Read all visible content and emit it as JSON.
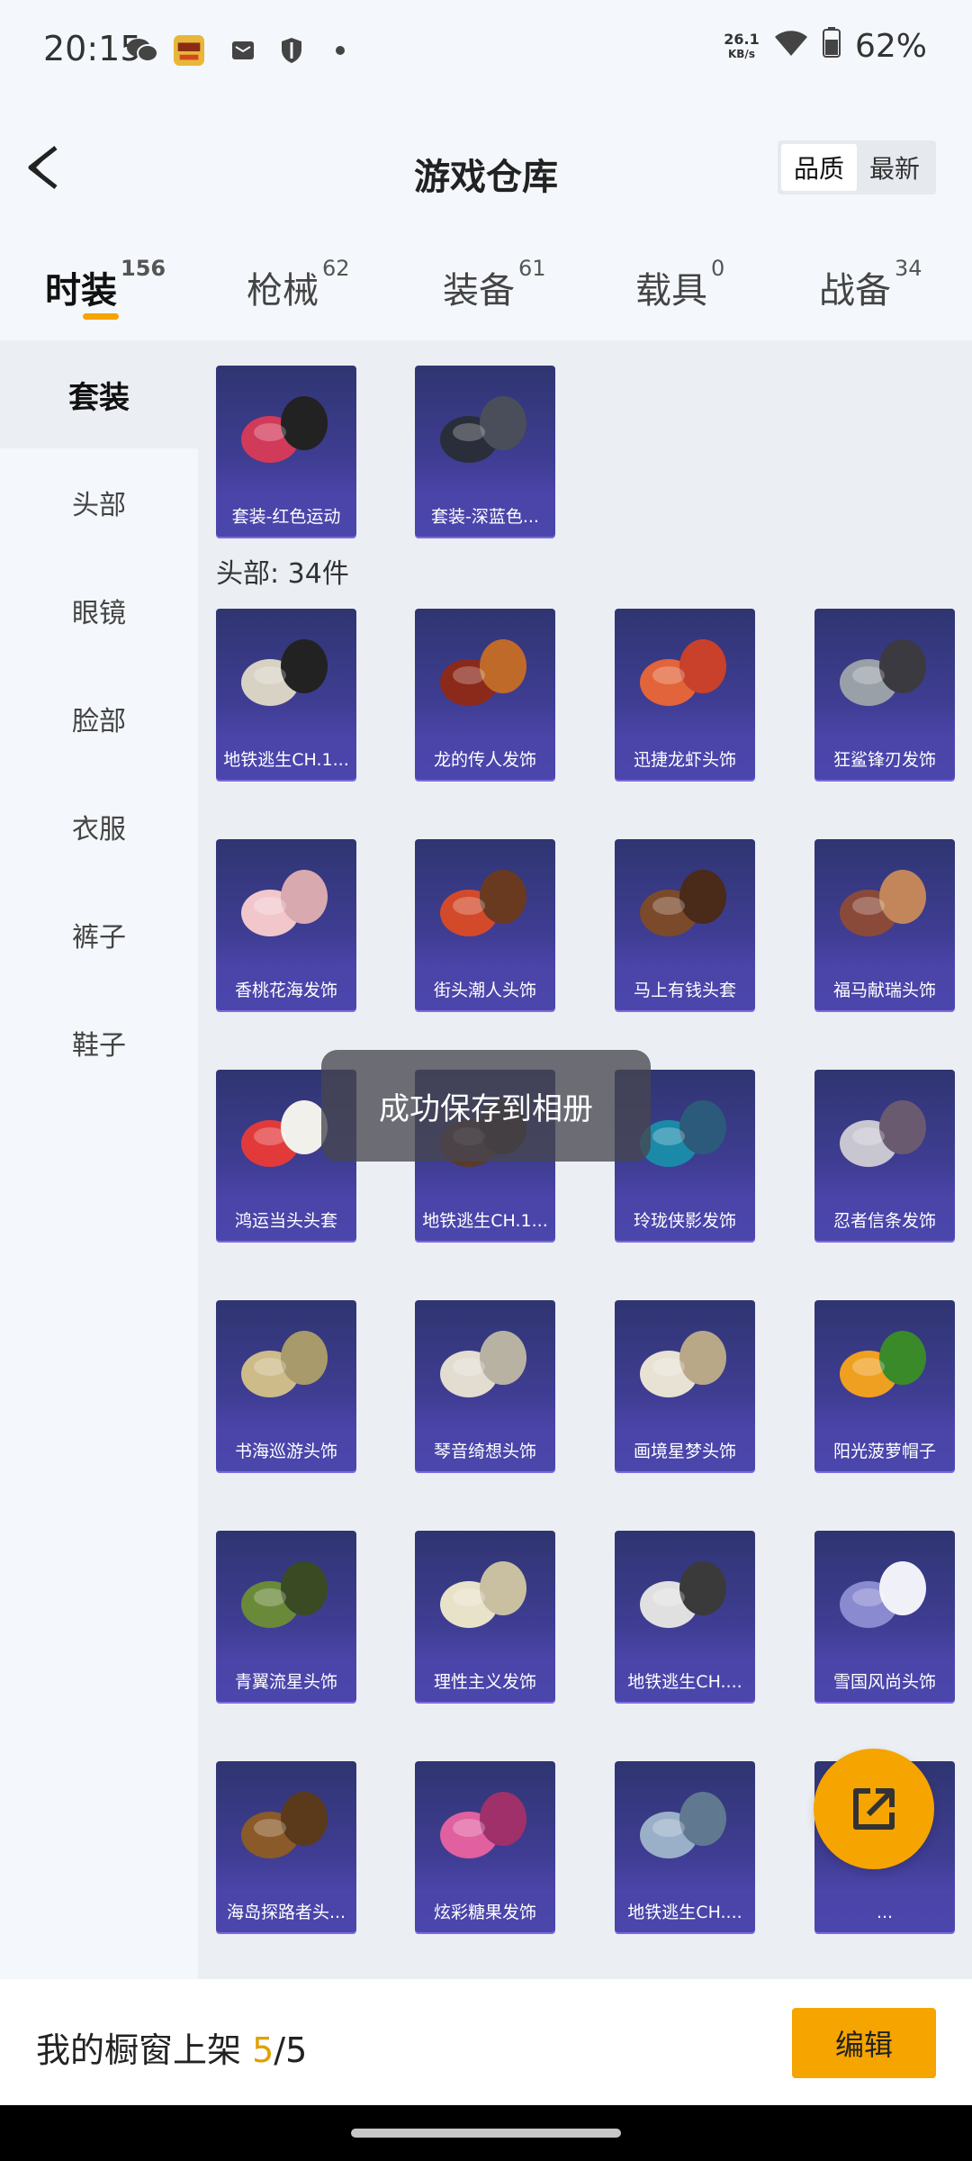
{
  "status_bar": {
    "time": "20:15",
    "speed_top": "26.1",
    "speed_unit": "KB/s",
    "battery": "62%",
    "icons": [
      "wechat-icon",
      "app-icon",
      "mail-icon",
      "shield-icon",
      "dot-icon",
      "wifi-icon",
      "battery-icon"
    ]
  },
  "header": {
    "title": "游戏仓库",
    "sort_options": [
      "品质",
      "最新"
    ],
    "active_sort": "品质"
  },
  "tabs": [
    {
      "label": "时装",
      "count": "156",
      "active": true
    },
    {
      "label": "枪械",
      "count": "62",
      "active": false
    },
    {
      "label": "装备",
      "count": "61",
      "active": false
    },
    {
      "label": "载具",
      "count": "0",
      "active": false
    },
    {
      "label": "战备",
      "count": "34",
      "active": false
    }
  ],
  "sidebar": {
    "items": [
      "套装",
      "头部",
      "眼镜",
      "脸部",
      "衣服",
      "裤子",
      "鞋子"
    ],
    "active": "套装"
  },
  "suits": {
    "items": [
      "套装-红色运动",
      "套装-深蓝色..."
    ]
  },
  "head_section": {
    "title": "头部: 34件",
    "items": [
      "地铁逃生CH.1...",
      "龙的传人发饰",
      "迅捷龙虾头饰",
      "狂鲨锋刃发饰",
      "香桃花海发饰",
      "街头潮人头饰",
      "马上有钱头套",
      "福马献瑞头饰",
      "鸿运当头头套",
      "地铁逃生CH.1...",
      "玲珑侠影发饰",
      "忍者信条发饰",
      "书海巡游头饰",
      "琴音绮想头饰",
      "画境星梦头饰",
      "阳光菠萝帽子",
      "青翼流星头饰",
      "理性主义发饰",
      "地铁逃生CH....",
      "雪国风尚头饰",
      "海岛探路者头...",
      "炫彩糖果发饰",
      "地铁逃生CH....",
      "..."
    ]
  },
  "toast": "成功保存到相册",
  "bottom_bar": {
    "prefix": "我的橱窗上架 ",
    "current": "5",
    "total": "/5",
    "edit_label": "编辑"
  },
  "colors": {
    "accent": "#f5a400",
    "card_top": "#2f3571",
    "card_bottom": "#5a4dc3"
  }
}
